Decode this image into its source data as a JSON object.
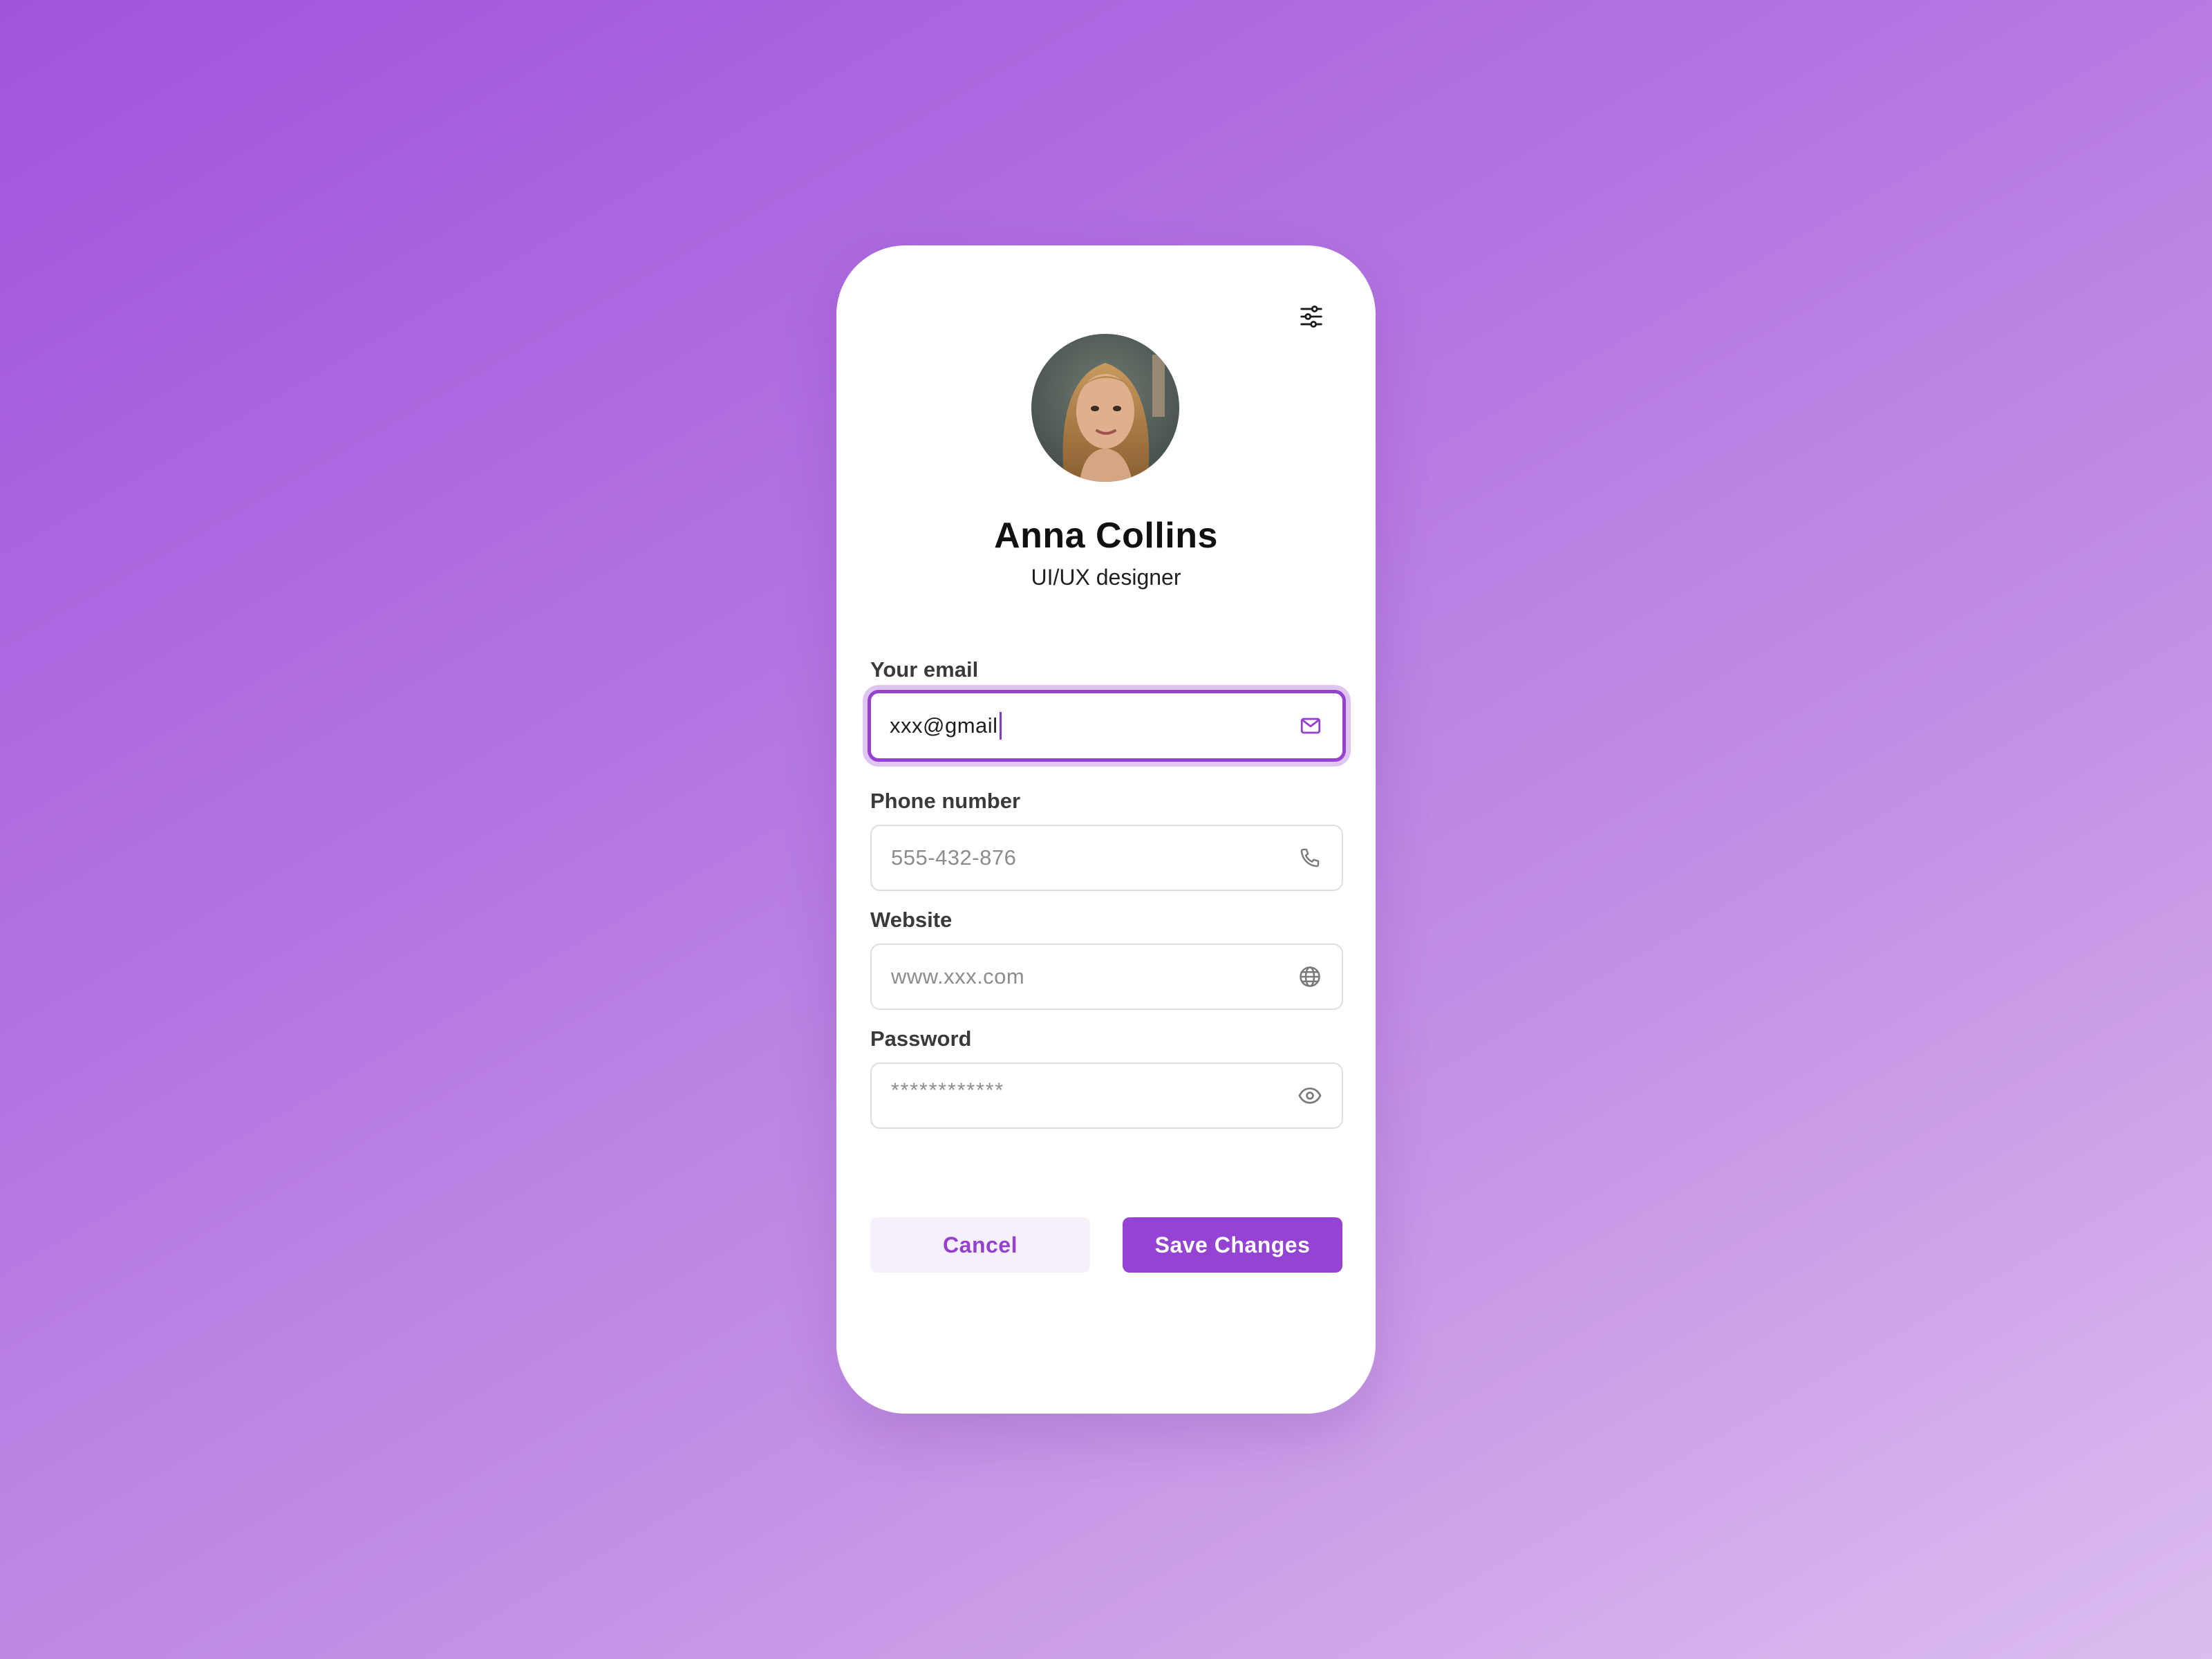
{
  "profile": {
    "name": "Anna Collins",
    "role": "UI/UX designer",
    "avatar_icon": "user-photo"
  },
  "header": {
    "settings_icon": "sliders-icon"
  },
  "form": {
    "email": {
      "label": "Your email",
      "value": "xxx@gmail",
      "icon": "mail-icon",
      "focused": true
    },
    "phone": {
      "label": "Phone number",
      "placeholder": "555-432-876",
      "icon": "phone-icon"
    },
    "website": {
      "label": "Website",
      "placeholder": "www.xxx.com",
      "icon": "globe-icon"
    },
    "password": {
      "label": "Password",
      "placeholder": "************",
      "icon": "eye-icon"
    }
  },
  "actions": {
    "cancel_label": "Cancel",
    "save_label": "Save Changes"
  },
  "colors": {
    "accent": "#9543d2",
    "accent_light": "#f6f0fc",
    "background_start": "#a054dc",
    "background_end": "#dcbdf0"
  }
}
